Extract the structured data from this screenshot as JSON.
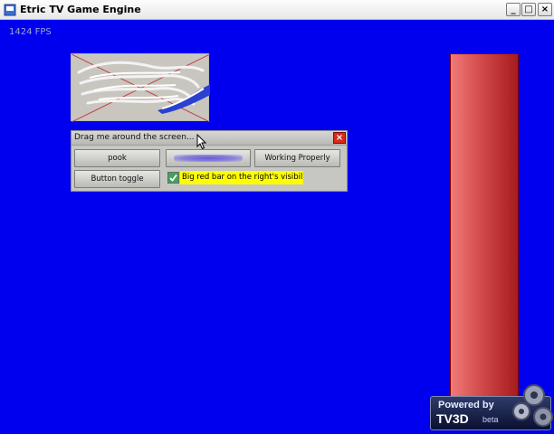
{
  "window": {
    "title": "Etric TV Game Engine",
    "minimize_glyph": "_",
    "maximize_glyph": "□",
    "close_glyph": "×"
  },
  "viewport": {
    "fps_text": "1424 FPS",
    "background": "#0000ee"
  },
  "dialog": {
    "title": "Drag me around the screen...",
    "close_glyph": "×",
    "buttons": {
      "pook": "pook",
      "working": "Working Properly",
      "toggle": "Button toggle"
    },
    "checkbox": {
      "label": "Big red bar on the right's visibility",
      "checked": true
    }
  },
  "watermark": {
    "line1": "Powered by",
    "line2": "TV3D",
    "line3": "beta"
  },
  "colors": {
    "red_bar": "#d24a4a",
    "highlight": "#ffff00",
    "dialog_close": "#d62a1c"
  }
}
